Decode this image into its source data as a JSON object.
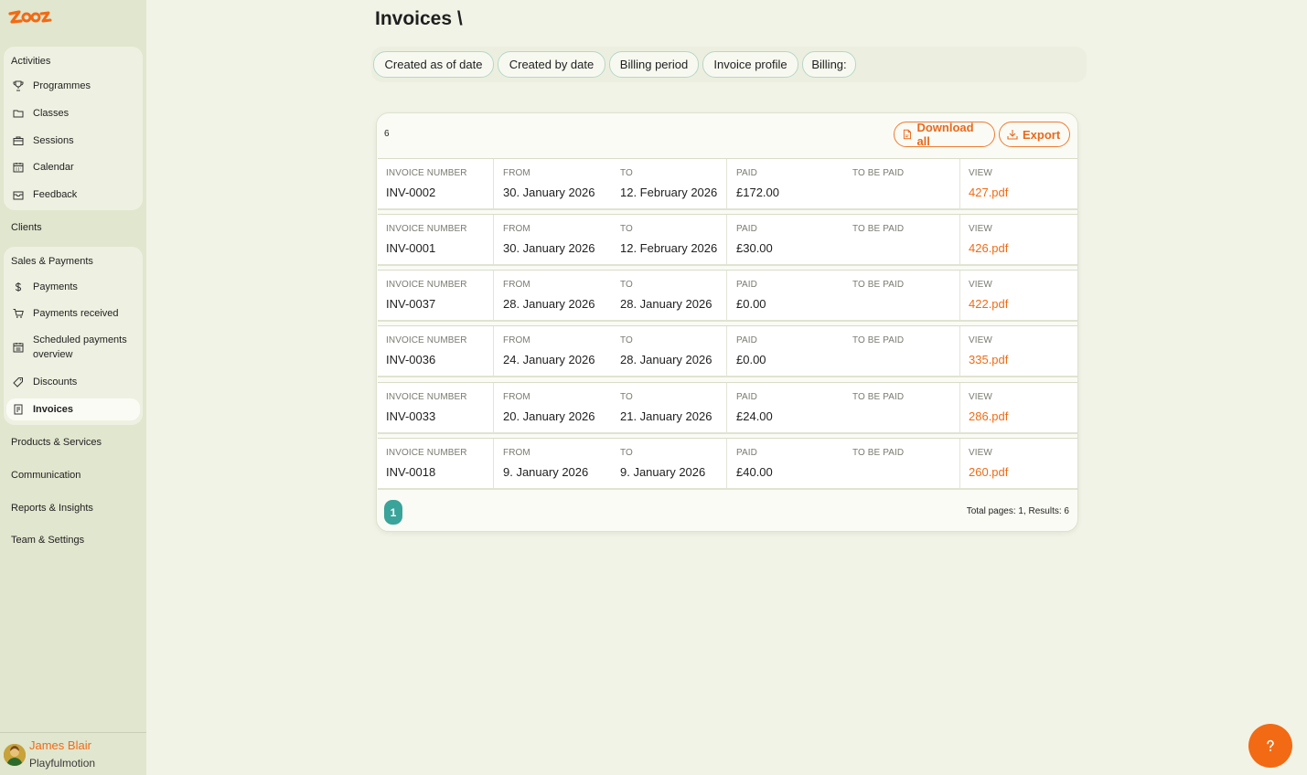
{
  "brand": {
    "logo_text": "zooza",
    "accent": "#f26a14",
    "teal": "#3aa39a"
  },
  "sidebar": {
    "activities_header": "Activities",
    "activities": [
      {
        "label": "Programmes",
        "icon": "trophy-icon"
      },
      {
        "label": "Classes",
        "icon": "folder-icon"
      },
      {
        "label": "Sessions",
        "icon": "briefcase-icon"
      },
      {
        "label": "Calendar",
        "icon": "calendar-icon"
      },
      {
        "label": "Feedback",
        "icon": "inbox-icon"
      }
    ],
    "clients": "Clients",
    "sales_header": "Sales & Payments",
    "sales": [
      {
        "label": "Payments",
        "icon": "coin-icon"
      },
      {
        "label": "Payments received",
        "icon": "cart-icon"
      },
      {
        "label": "Scheduled payments overview",
        "icon": "schedule-icon"
      },
      {
        "label": "Discounts",
        "icon": "tag-icon"
      },
      {
        "label": "Invoices",
        "icon": "invoice-icon",
        "active": true
      }
    ],
    "products": "Products & Services",
    "communication": "Communication",
    "reports": "Reports & Insights",
    "team": "Team & Settings"
  },
  "user": {
    "name": "James Blair",
    "org": "Playfulmotion"
  },
  "page": {
    "title": "Invoices \\"
  },
  "filters": [
    "Created as of date",
    "Created by date",
    "Billing period",
    "Invoice profile",
    "Billing:"
  ],
  "toolbar": {
    "count": "6",
    "download_all": "Download all",
    "export": "Export"
  },
  "columns": {
    "number": "INVOICE NUMBER",
    "from": "FROM",
    "to": "TO",
    "paid": "PAID",
    "to_be_paid": "TO BE PAID",
    "view": "VIEW"
  },
  "invoices": [
    {
      "number": "INV-0002",
      "from": "30. January 2026",
      "to": "12. February 2026",
      "paid": "£172.00",
      "to_be_paid": "",
      "file": "427.pdf"
    },
    {
      "number": "INV-0001",
      "from": "30. January 2026",
      "to": "12. February 2026",
      "paid": "£30.00",
      "to_be_paid": "",
      "file": "426.pdf"
    },
    {
      "number": "INV-0037",
      "from": "28. January 2026",
      "to": "28. January 2026",
      "paid": "£0.00",
      "to_be_paid": "",
      "file": "422.pdf"
    },
    {
      "number": "INV-0036",
      "from": "24. January 2026",
      "to": "28. January 2026",
      "paid": "£0.00",
      "to_be_paid": "",
      "file": "335.pdf"
    },
    {
      "number": "INV-0033",
      "from": "20. January 2026",
      "to": "21. January 2026",
      "paid": "£24.00",
      "to_be_paid": "",
      "file": "286.pdf"
    },
    {
      "number": "INV-0018",
      "from": "9. January 2026",
      "to": "9. January 2026",
      "paid": "£40.00",
      "to_be_paid": "",
      "file": "260.pdf"
    }
  ],
  "pagination": {
    "current": "1",
    "summary": "Total pages: 1, Results: 6"
  }
}
